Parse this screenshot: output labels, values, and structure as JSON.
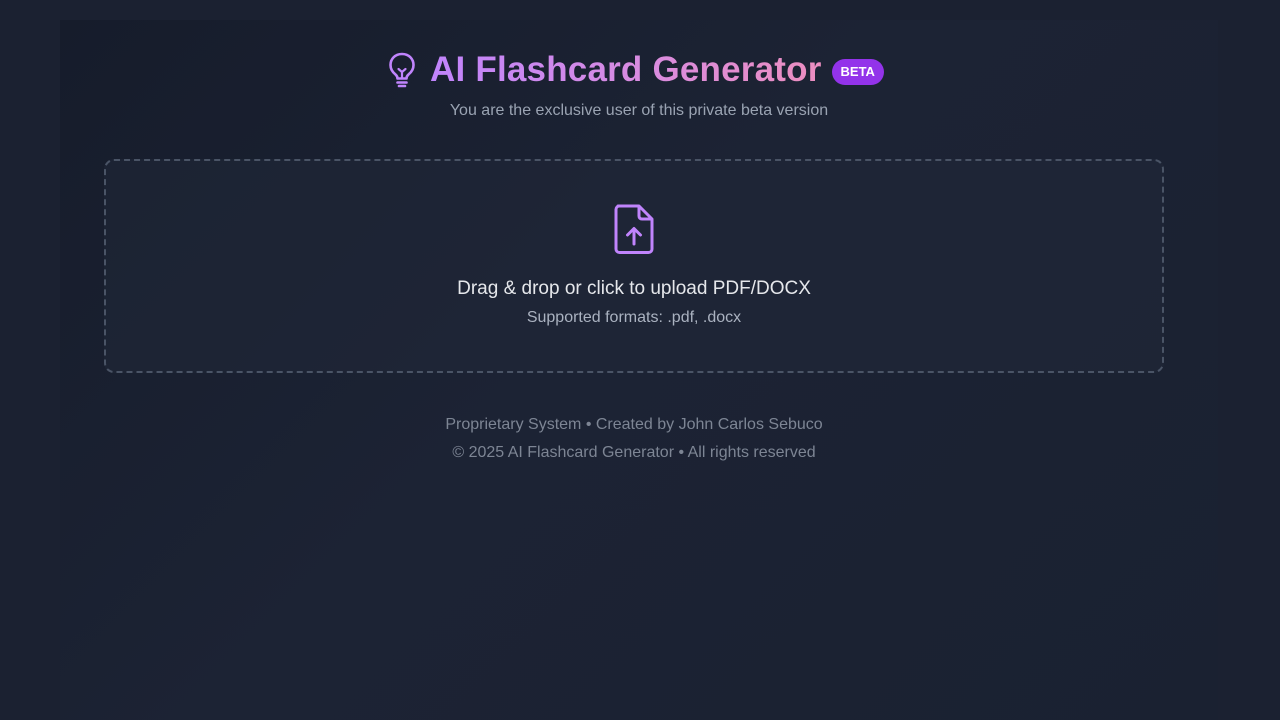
{
  "header": {
    "icon": "lightbulb-icon",
    "title": "AI Flashcard Generator",
    "badge": "BETA",
    "subtitle": "You are the exclusive user of this private beta version"
  },
  "upload": {
    "icon": "file-upload-icon",
    "label": "Drag & drop or click to upload PDF/DOCX",
    "formats": "Supported formats: .pdf, .docx"
  },
  "footer": {
    "line1": "Proprietary System • Created by John Carlos Sebuco",
    "line2": "© 2025 AI Flashcard Generator • All rights reserved"
  },
  "colors": {
    "accent": "#c084fc",
    "badge_bg": "#9333ea",
    "background": "#1b2131"
  }
}
